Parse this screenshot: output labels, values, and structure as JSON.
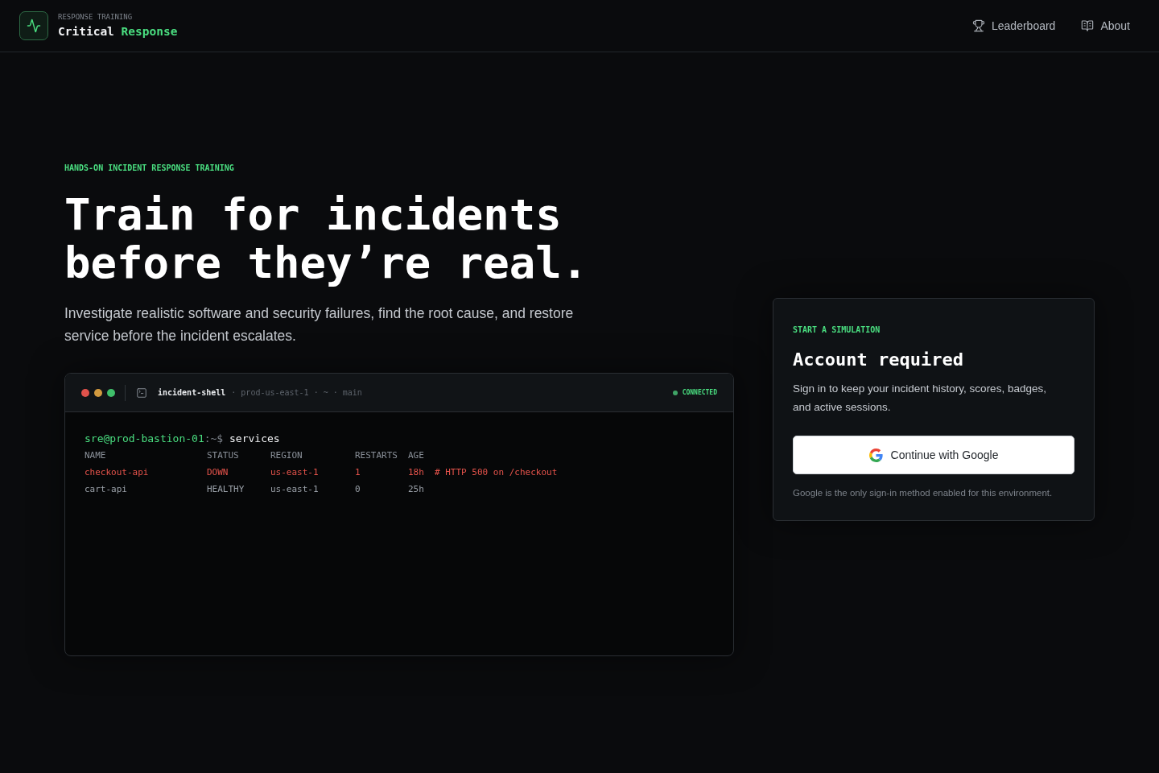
{
  "header": {
    "tagline": "RESPONSE TRAINING",
    "brand": "Critical",
    "brand_accent": "Response",
    "nav": [
      {
        "label": "Leaderboard"
      },
      {
        "label": "About"
      }
    ]
  },
  "hero": {
    "eyebrow": "HANDS-ON INCIDENT RESPONSE TRAINING",
    "title": "Train for incidents before they’re real.",
    "description": "Investigate realistic software and security failures, find the root cause, and restore service before the incident escalates."
  },
  "terminal": {
    "title": "incident-shell",
    "meta": "· prod-us-east-1 · ~ · main",
    "status": "CONNECTED",
    "prompt": {
      "user": "sre@prod-bastion-01",
      "path": ":~$",
      "command": "services"
    },
    "columns": [
      "NAME",
      "STATUS",
      "REGION",
      "RESTARTS",
      "AGE"
    ],
    "rows": [
      {
        "cells": [
          "checkout-api",
          "DOWN",
          "us-east-1",
          "1",
          "18h"
        ],
        "comment": "# HTTP 500 on /checkout",
        "failing": true
      },
      {
        "cells": [
          "cart-api",
          "HEALTHY",
          "us-east-1",
          "0",
          "25h"
        ],
        "failing": false
      }
    ]
  },
  "signin": {
    "eyebrow": "START A SIMULATION",
    "title": "Account required",
    "description": "Sign in to keep your incident history, scores, badges, and active sessions.",
    "button": "Continue with Google",
    "note": "Google is the only sign-in method enabled for this environment."
  }
}
